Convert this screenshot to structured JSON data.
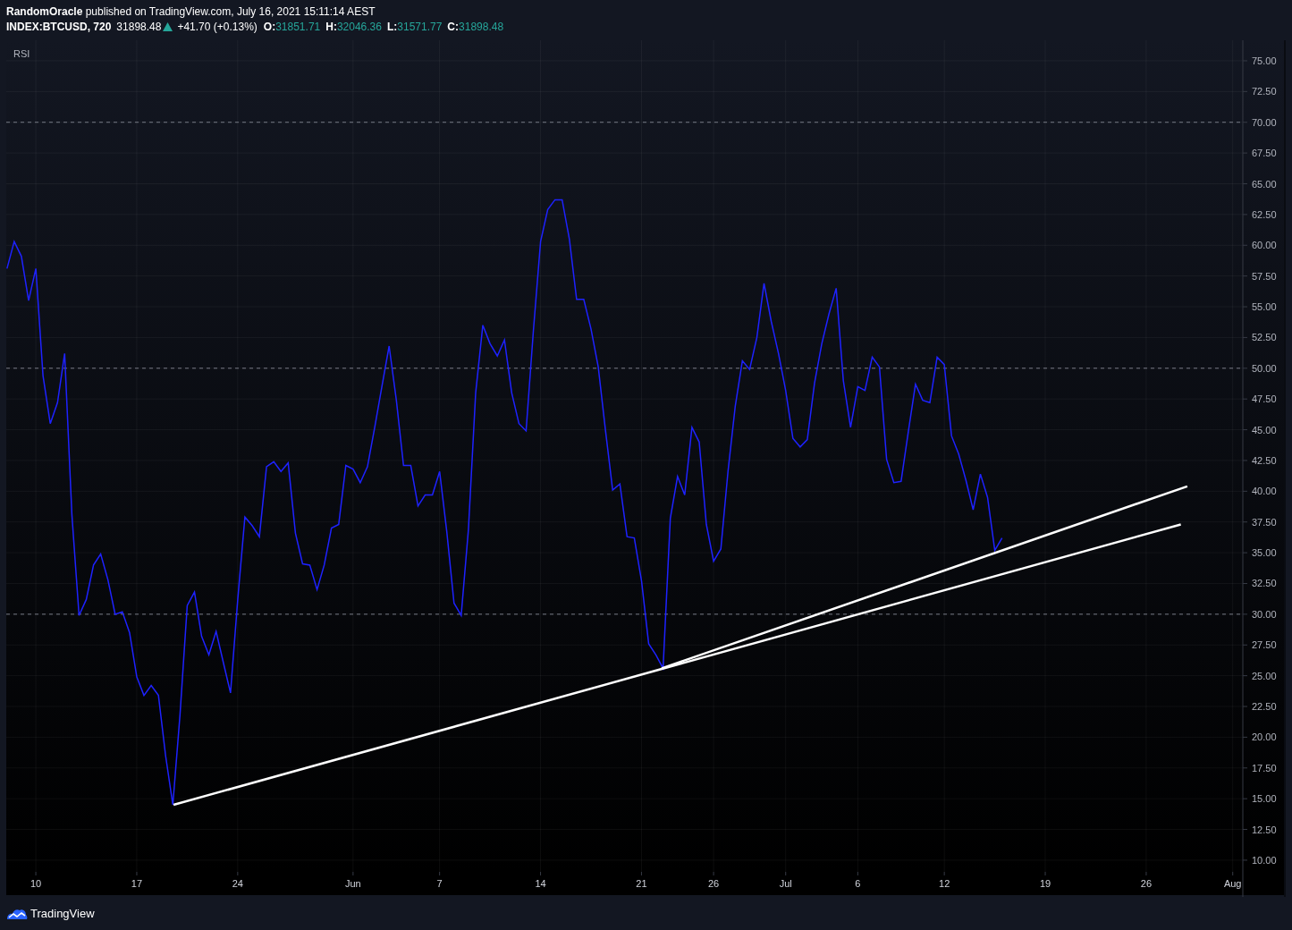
{
  "header": {
    "publisher": "**RandomOracle** published on TradingView.com, July 16, 2021 15:11:14 AEST",
    "symbol": "INDEX:BTCUSD, 720",
    "price": "31898.48",
    "change": "+41.70 (+0.13%)",
    "ohlc": [
      {
        "label": "O:",
        "value": "31851.71"
      },
      {
        "label": "H:",
        "value": "32046.36"
      },
      {
        "label": "L:",
        "value": "31571.77"
      },
      {
        "label": "C:",
        "value": "31898.48"
      }
    ]
  },
  "chart": {
    "chart_data": {
      "type": "line",
      "categories": [
        null,
        null,
        null,
        null,
        "10",
        null,
        null,
        null,
        null,
        null,
        null,
        null,
        null,
        null,
        null,
        null,
        null,
        null,
        "17",
        null,
        null,
        null,
        null,
        null,
        null,
        null,
        null,
        null,
        null,
        null,
        null,
        null,
        "24",
        null,
        null,
        null,
        null,
        null,
        null,
        null,
        null,
        null,
        null,
        null,
        null,
        null,
        null,
        null,
        "Jun",
        null,
        null,
        null,
        null,
        null,
        null,
        null,
        null,
        null,
        null,
        null,
        "7",
        null,
        null,
        null,
        null,
        null,
        null,
        null,
        null,
        null,
        null,
        null,
        null,
        null,
        "14",
        null,
        null,
        null,
        null,
        null,
        null,
        null,
        null,
        null,
        null,
        null,
        null,
        null,
        "21",
        null,
        null,
        null,
        null,
        null,
        null,
        null,
        null,
        null,
        "26",
        null,
        null,
        null,
        null,
        null,
        null,
        null,
        null,
        null,
        "Jul",
        null,
        null,
        null,
        null,
        null,
        null,
        null,
        null,
        null,
        "6",
        null,
        null,
        null,
        null,
        null,
        null,
        null,
        null,
        null,
        null,
        null,
        "12",
        null,
        null,
        null,
        null,
        null,
        null,
        null,
        null,
        null,
        null,
        null,
        null,
        null,
        "19",
        null,
        null,
        null,
        null,
        null,
        null,
        null,
        null,
        null,
        null,
        null,
        null,
        null,
        "26",
        null,
        null,
        null,
        null,
        null,
        null,
        null,
        null,
        null,
        null,
        null,
        "Aug",
        null
      ],
      "series": [
        {
          "name": "RSI",
          "color": "#1e22ff",
          "values": [
            58.1,
            60.3,
            59.1,
            55.5,
            58.1,
            49.4,
            45.5,
            47.2,
            51.2,
            38.1,
            29.9,
            31.2,
            34.0,
            34.9,
            32.8,
            30.0,
            30.2,
            28.5,
            24.9,
            23.4,
            24.2,
            23.4,
            18.5,
            14.5,
            21.8,
            30.7,
            31.8,
            28.2,
            26.7,
            28.6,
            26.1,
            23.6,
            31.2,
            37.9,
            37.2,
            36.3,
            42.0,
            42.4,
            41.6,
            42.3,
            36.6,
            34.1,
            34.0,
            32.0,
            34.0,
            37.0,
            37.3,
            42.1,
            41.8,
            40.7,
            42.0,
            45.2,
            48.5,
            51.8,
            47.4,
            42.1,
            42.1,
            38.8,
            39.7,
            39.7,
            41.6,
            36.7,
            30.9,
            29.9,
            36.9,
            48.0,
            53.5,
            52.0,
            51.0,
            52.3,
            48.0,
            45.5,
            44.9,
            53.0,
            60.3,
            62.9,
            63.7,
            63.7,
            60.5,
            55.6,
            55.6,
            53.2,
            50.1,
            45.0,
            40.1,
            40.6,
            36.3,
            36.2,
            32.7,
            27.6,
            26.7,
            25.6,
            37.8,
            41.2,
            39.7,
            45.2,
            44.0,
            37.3,
            34.3,
            35.3,
            41.6,
            46.9,
            50.6,
            49.9,
            52.5,
            56.9,
            53.8,
            51.2,
            48.2,
            44.3,
            43.6,
            44.2,
            48.8,
            52.0,
            54.4,
            56.5,
            49.0,
            45.2,
            48.5,
            48.2,
            50.9,
            50.1,
            42.6,
            40.7,
            40.8,
            44.8,
            48.7,
            47.4,
            47.2,
            50.9,
            50.3,
            44.5,
            43.0,
            40.9,
            38.5,
            41.4,
            39.5,
            35.2,
            36.2,
            null,
            null,
            null,
            null,
            null,
            null,
            null,
            null,
            null,
            null,
            null,
            null,
            null,
            null,
            null,
            null,
            null,
            null,
            null,
            null,
            null,
            null,
            null,
            null,
            null,
            null,
            null,
            null,
            null,
            null,
            null,
            null,
            null
          ]
        }
      ],
      "ylim": [
        9.05,
        76.67
      ],
      "grid": true,
      "yticks": [
        {
          "value": 75,
          "label": "75.00"
        },
        {
          "value": 72.5,
          "label": "72.50"
        },
        {
          "value": 70,
          "label": "70.00"
        },
        {
          "value": 67.5,
          "label": "67.50"
        },
        {
          "value": 65,
          "label": "65.00"
        },
        {
          "value": 62.5,
          "label": "62.50"
        },
        {
          "value": 60,
          "label": "60.00"
        },
        {
          "value": 57.5,
          "label": "57.50"
        },
        {
          "value": 55,
          "label": "55.00"
        },
        {
          "value": 52.5,
          "label": "52.50"
        },
        {
          "value": 50,
          "label": "50.00"
        },
        {
          "value": 47.5,
          "label": "47.50"
        },
        {
          "value": 45,
          "label": "45.00"
        },
        {
          "value": 42.5,
          "label": "42.50"
        },
        {
          "value": 40,
          "label": "40.00"
        },
        {
          "value": 37.5,
          "label": "37.50"
        },
        {
          "value": 35,
          "label": "35.00"
        },
        {
          "value": 32.5,
          "label": "32.50"
        },
        {
          "value": 30,
          "label": "30.00"
        },
        {
          "value": 27.5,
          "label": "27.50"
        },
        {
          "value": 25,
          "label": "25.00"
        },
        {
          "value": 22.5,
          "label": "22.50"
        },
        {
          "value": 20,
          "label": "20.00"
        },
        {
          "value": 17.5,
          "label": "17.50"
        },
        {
          "value": 15,
          "label": "15.00"
        },
        {
          "value": 12.5,
          "label": "12.50"
        },
        {
          "value": 10,
          "label": "10.00"
        }
      ]
    }
  },
  "footer": {
    "brand": "TradingView"
  }
}
